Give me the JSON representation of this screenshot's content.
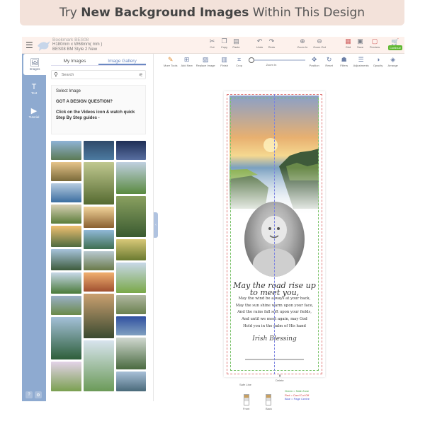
{
  "banner": {
    "prefix": "Try ",
    "bold": "New Background Images",
    "suffix": " Within This Design"
  },
  "header": {
    "product_code": "Bookmark BES08",
    "dimensions": "H180mm x W68mm( mm )",
    "style": "BES08 BM Style 2 New",
    "tools": [
      {
        "label": "Cut",
        "icon": "cut-icon"
      },
      {
        "label": "Copy",
        "icon": "copy-icon"
      },
      {
        "label": "Paste",
        "icon": "paste-icon"
      },
      {
        "label": "Undo",
        "icon": "undo-icon"
      },
      {
        "label": "Redo",
        "icon": "redo-icon"
      },
      {
        "label": "Zoom In",
        "icon": "zoom-in-icon"
      },
      {
        "label": "Zoom Out",
        "icon": "zoom-out-icon"
      },
      {
        "label": "Grid",
        "icon": "grid-icon"
      },
      {
        "label": "Save",
        "icon": "save-icon"
      },
      {
        "label": "Preview",
        "icon": "preview-icon"
      }
    ],
    "continue_label": "Continue"
  },
  "rail": {
    "items": [
      {
        "label": "Images",
        "icon": "images-icon"
      },
      {
        "label": "Text",
        "icon": "text-icon"
      },
      {
        "label": "Tutorial",
        "icon": "tutorial-icon"
      }
    ],
    "footer": [
      "?",
      "⚙"
    ]
  },
  "panel": {
    "tabs": [
      "My Images",
      "Image Gallery"
    ],
    "active_tab": "Image Gallery",
    "search_placeholder": "Search",
    "info": {
      "heading": "Select Image",
      "question": "GOT A DESIGN QUESTION?",
      "guide": "Click on the Videos icon & watch quick Step By Step guides -"
    }
  },
  "editor_tools": [
    {
      "label": "More Tools",
      "icon": "more-tools-icon"
    },
    {
      "label": "Add New",
      "icon": "add-image-icon"
    },
    {
      "label": "Replace Image",
      "icon": "replace-image-icon"
    },
    {
      "label": "Finish",
      "icon": "finish-icon"
    },
    {
      "label": "Crop",
      "icon": "crop-icon"
    }
  ],
  "zoom_label": "Zoom In",
  "editor_tools_right": [
    {
      "label": "Position",
      "icon": "position-icon"
    },
    {
      "label": "Reset",
      "icon": "reset-icon"
    },
    {
      "label": "Filters",
      "icon": "filters-icon"
    },
    {
      "label": "Adjustments",
      "icon": "adjustments-icon"
    },
    {
      "label": "Opacity",
      "icon": "opacity-icon"
    },
    {
      "label": "Arrange",
      "icon": "arrange-icon"
    }
  ],
  "design": {
    "verse_first": "May the road rise up to meet you,",
    "verse_lines": [
      "May the wind be always at your back,",
      "May the sun shine warm upon your face,",
      "And the rains fall soft upon your fields,",
      "And until we meet again, may God",
      "Hold you in the palm of His hand"
    ],
    "signature": "Irish Blessing"
  },
  "canvas_labels": {
    "safe_line": "Safe Line",
    "delete": "Delete",
    "front": "Front",
    "back": "Back"
  },
  "legend": {
    "green": "Green = Safe Zone",
    "red": "Red = Card Cut Off",
    "blue": "Blue = Page Centre"
  }
}
